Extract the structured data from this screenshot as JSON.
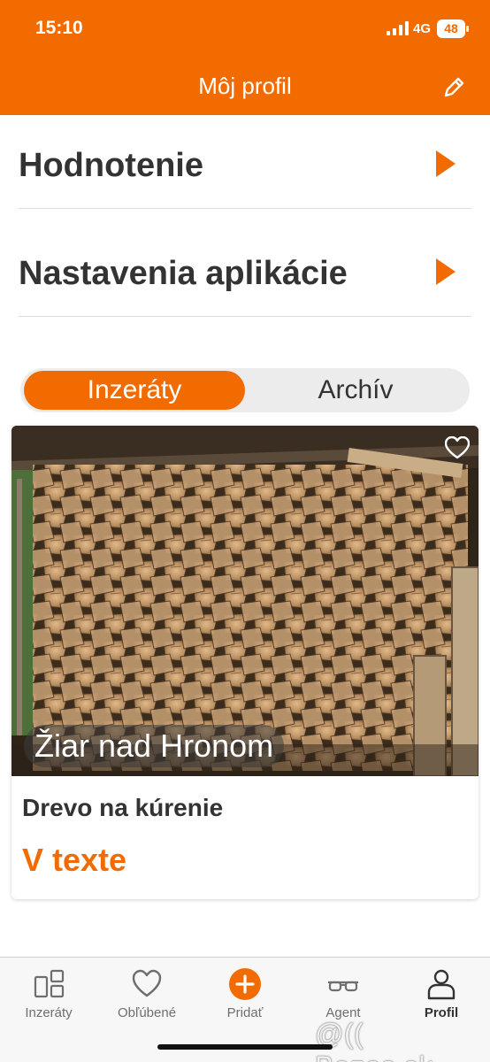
{
  "status_bar": {
    "time": "15:10",
    "network": "4G",
    "battery": "48"
  },
  "nav": {
    "title": "Môj profil",
    "edit_icon": "pencil-icon"
  },
  "menu": [
    {
      "label": "Hodnotenie",
      "icon": "chevron-right-icon"
    },
    {
      "label": "Nastavenia aplikácie",
      "icon": "chevron-right-icon"
    }
  ],
  "segments": {
    "active": "Inzeráty",
    "inactive": "Archív"
  },
  "listing": {
    "location": "Žiar nad Hronom",
    "title": "Drevo na kúrenie",
    "price": "V texte",
    "favorite_icon": "heart-outline-icon"
  },
  "tabs": [
    {
      "label": "Inzeráty",
      "icon": "grid-icon"
    },
    {
      "label": "Obľúbené",
      "icon": "heart-icon"
    },
    {
      "label": "Pridať",
      "icon": "plus-circle-icon"
    },
    {
      "label": "Agent",
      "icon": "glasses-icon"
    },
    {
      "label": "Profil",
      "icon": "person-icon"
    }
  ],
  "watermark": "@(( Bazos.sk",
  "colors": {
    "accent": "#f26b00",
    "background": "#ffffff",
    "tabbar": "#f7f7f7"
  }
}
